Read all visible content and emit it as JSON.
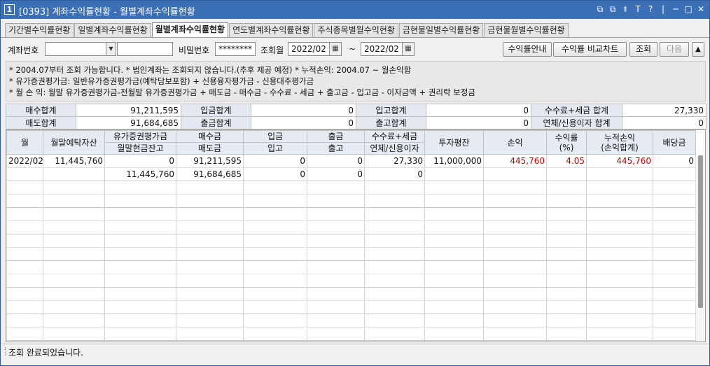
{
  "window": {
    "number": "1",
    "title": "[0393] 계좌수익률현황 - 월별계좌수익률현황",
    "controls": [
      "⧉",
      "⧉",
      "⯒",
      "T",
      "?",
      "|",
      "─",
      "□",
      "✕"
    ]
  },
  "tabs": [
    {
      "label": "기간별수익률현황",
      "active": false
    },
    {
      "label": "일별계좌수익률현황",
      "active": false
    },
    {
      "label": "월별계좌수익률현황",
      "active": true
    },
    {
      "label": "연도별계좌수익률현황",
      "active": false
    },
    {
      "label": "주식종목별월수익현황",
      "active": false
    },
    {
      "label": "금현물일별수익률현황",
      "active": false
    },
    {
      "label": "금현물월별수익률현황",
      "active": false
    }
  ],
  "search": {
    "account_label": "계좌번호",
    "account_value": "",
    "account_name_value": "",
    "password_label": "비밀번호",
    "password_value": "********",
    "month_label": "조회월",
    "from_month": "2022/02",
    "tilde": "~",
    "to_month": "2022/02",
    "btn_guide": "수익률안내",
    "btn_compare": "수익률 비교차트",
    "btn_query": "조회",
    "btn_next": "다음",
    "btn_up": "▲"
  },
  "notice": [
    "* 2004.07부터 조회 가능합니다.   * 법인계좌는 조회되지 않습니다.(추후 제공 예정)   * 누적손익: 2004.07 ~ 월손익합",
    "* 유가증권평가금: 일반유가증권평가금(예탁담보포함) + 신용융자평가금 - 신용대주평가금",
    "* 월 손 익: 월말 유가증권평가금-전월말 유가증권평가금 + 매도금 - 매수금 - 수수료 - 세금 + 출고금 - 입고금 - 이자금액 + 권리락 보정금"
  ],
  "summary": {
    "rows": [
      [
        {
          "label": "매수합계",
          "value": "91,211,595"
        },
        {
          "label": "입금합계",
          "value": "0"
        },
        {
          "label": "입고합계",
          "value": "0"
        },
        {
          "label": "수수료+세금 합계",
          "value": "27,330"
        }
      ],
      [
        {
          "label": "매도합계",
          "value": "91,684,685"
        },
        {
          "label": "출금합계",
          "value": "0"
        },
        {
          "label": "출고합계",
          "value": "0"
        },
        {
          "label": "연체/신용이자 합계",
          "value": "0"
        }
      ]
    ]
  },
  "grid": {
    "headers_top": [
      "월",
      "월말예탁자산",
      "유가증권평가금",
      "매수금",
      "입금",
      "출금",
      "수수료+세금",
      "투자평잔",
      "손익",
      "수익률\n(%)",
      "누적손익\n(손익합계)",
      "배당금"
    ],
    "headers_bottom": [
      "월말현금잔고",
      "매도금",
      "입고",
      "출고",
      "연체/신용이자"
    ],
    "records": [
      {
        "month": "2022/02",
        "deposit_assets": "11,445,760",
        "securities_eval": "0",
        "buy_amount": "91,211,595",
        "deposit": "0",
        "withdraw": "0",
        "fee_tax": "27,330",
        "invest_avg": "11,000,000",
        "pnl": "445,760",
        "return_rate": "4.05",
        "cum_pnl": "445,760",
        "dividend": "0",
        "cash_balance": "11,445,760",
        "sell_amount": "91,684,685",
        "stock_in": "0",
        "stock_out": "0",
        "interest": "0"
      }
    ],
    "empty_pair_count": 6,
    "colors": {
      "negative_or_profit": "#c00000"
    }
  },
  "status": {
    "message": "조회 완료되었습니다."
  }
}
